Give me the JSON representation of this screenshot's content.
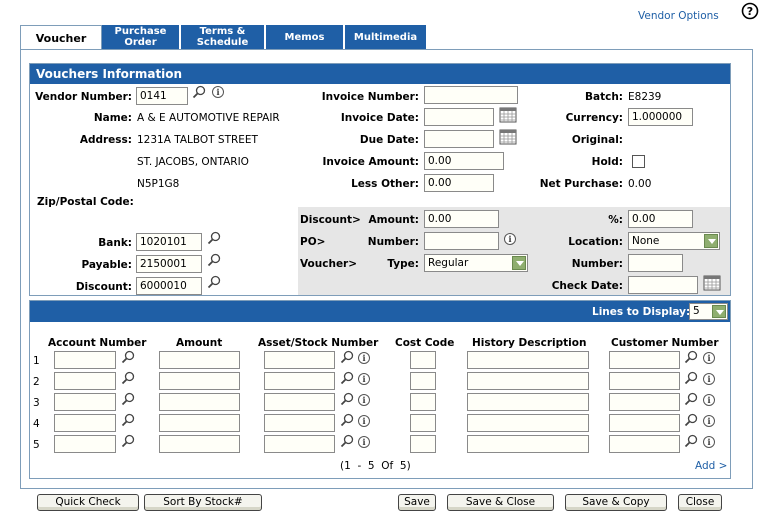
{
  "header": {
    "vendor_options": "Vendor Options",
    "help_icon": "help-icon"
  },
  "tabs": [
    {
      "label": "Voucher"
    },
    {
      "label": "Purchase\nOrder"
    },
    {
      "label": "Terms &\nSchedule"
    },
    {
      "label": "Memos"
    },
    {
      "label": "Multimedia"
    }
  ],
  "vouchers_info": {
    "title": "Vouchers Information",
    "vendor_number_label": "Vendor Number:",
    "vendor_number": "0141",
    "name_label": "Name:",
    "name": "A & E AUTOMOTIVE REPAIR",
    "address_label": "Address:",
    "address_line1": "1231A TALBOT STREET",
    "address_line2": "ST. JACOBS, ONTARIO",
    "address_line3": "N5P1G8",
    "zip_label": "Zip/Postal Code:",
    "bank_label": "Bank:",
    "bank": "1020101",
    "payable_label": "Payable:",
    "payable": "2150001",
    "discount_label": "Discount:",
    "discount": "6000010",
    "invoice_number_label": "Invoice Number:",
    "invoice_number": "",
    "invoice_date_label": "Invoice Date:",
    "invoice_date": "",
    "due_date_label": "Due Date:",
    "due_date": "",
    "invoice_amount_label": "Invoice Amount:",
    "invoice_amount": "0.00",
    "less_other_label": "Less Other:",
    "less_other": "0.00",
    "batch_label": "Batch:",
    "batch": "E8239",
    "currency_label": "Currency:",
    "currency": "1.000000",
    "original_label": "Original:",
    "hold_label": "Hold:",
    "net_purchase_label": "Net Purchase:",
    "net_purchase": "0.00"
  },
  "discount_section": {
    "discount_group": "Discount>",
    "amount_label": "Amount:",
    "amount": "0.00",
    "percent_label": "%:",
    "percent": "0.00",
    "po_group": "PO>",
    "number_label": "Number:",
    "po_number": "",
    "location_label": "Location:",
    "location": "None",
    "voucher_group": "Voucher>",
    "type_label": "Type:",
    "type": "Regular",
    "voucher_number_label": "Number:",
    "voucher_number": "",
    "check_date_label": "Check Date:",
    "check_date": ""
  },
  "lines": {
    "lines_to_display_label": "Lines to Display:",
    "lines_to_display": "5",
    "columns": [
      "Account Number",
      "Amount",
      "Asset/Stock Number",
      "Cost Code",
      "History Description",
      "Customer Number"
    ],
    "rows": [
      "1",
      "2",
      "3",
      "4",
      "5"
    ],
    "pagination": "(1  -  5  Of  5)",
    "add_link": "Add >"
  },
  "buttons": {
    "quick_check": "Quick Check",
    "sort_by_stock": "Sort By Stock#",
    "save": "Save",
    "save_close": "Save & Close",
    "save_copy": "Save & Copy",
    "close": "Close"
  }
}
